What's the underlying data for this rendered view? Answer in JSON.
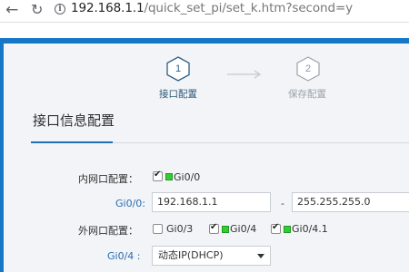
{
  "browser": {
    "url_host": "192.168.1.1",
    "url_path": "/quick_set_pi/set_k.htm?second=y"
  },
  "wizard": {
    "steps": [
      {
        "number": "1",
        "label": "接口配置"
      },
      {
        "number": "2",
        "label": "保存配置"
      }
    ]
  },
  "section": {
    "title": "接口信息配置"
  },
  "form": {
    "lan": {
      "label": "内网口配置：",
      "options": [
        {
          "name": "Gi0/0",
          "checked": true
        }
      ]
    },
    "gi00": {
      "label": "Gi0/0:",
      "ip": "192.168.1.1",
      "separator": "-",
      "mask": "255.255.255.0"
    },
    "wan": {
      "label": "外网口配置：",
      "options": [
        {
          "name": "Gi0/3",
          "checked": false
        },
        {
          "name": "Gi0/4",
          "checked": true
        },
        {
          "name": "Gi0/4.1",
          "checked": true
        }
      ]
    },
    "gi04": {
      "label": "Gi0/4 :",
      "mode": "动态IP(DHCP)"
    }
  }
}
